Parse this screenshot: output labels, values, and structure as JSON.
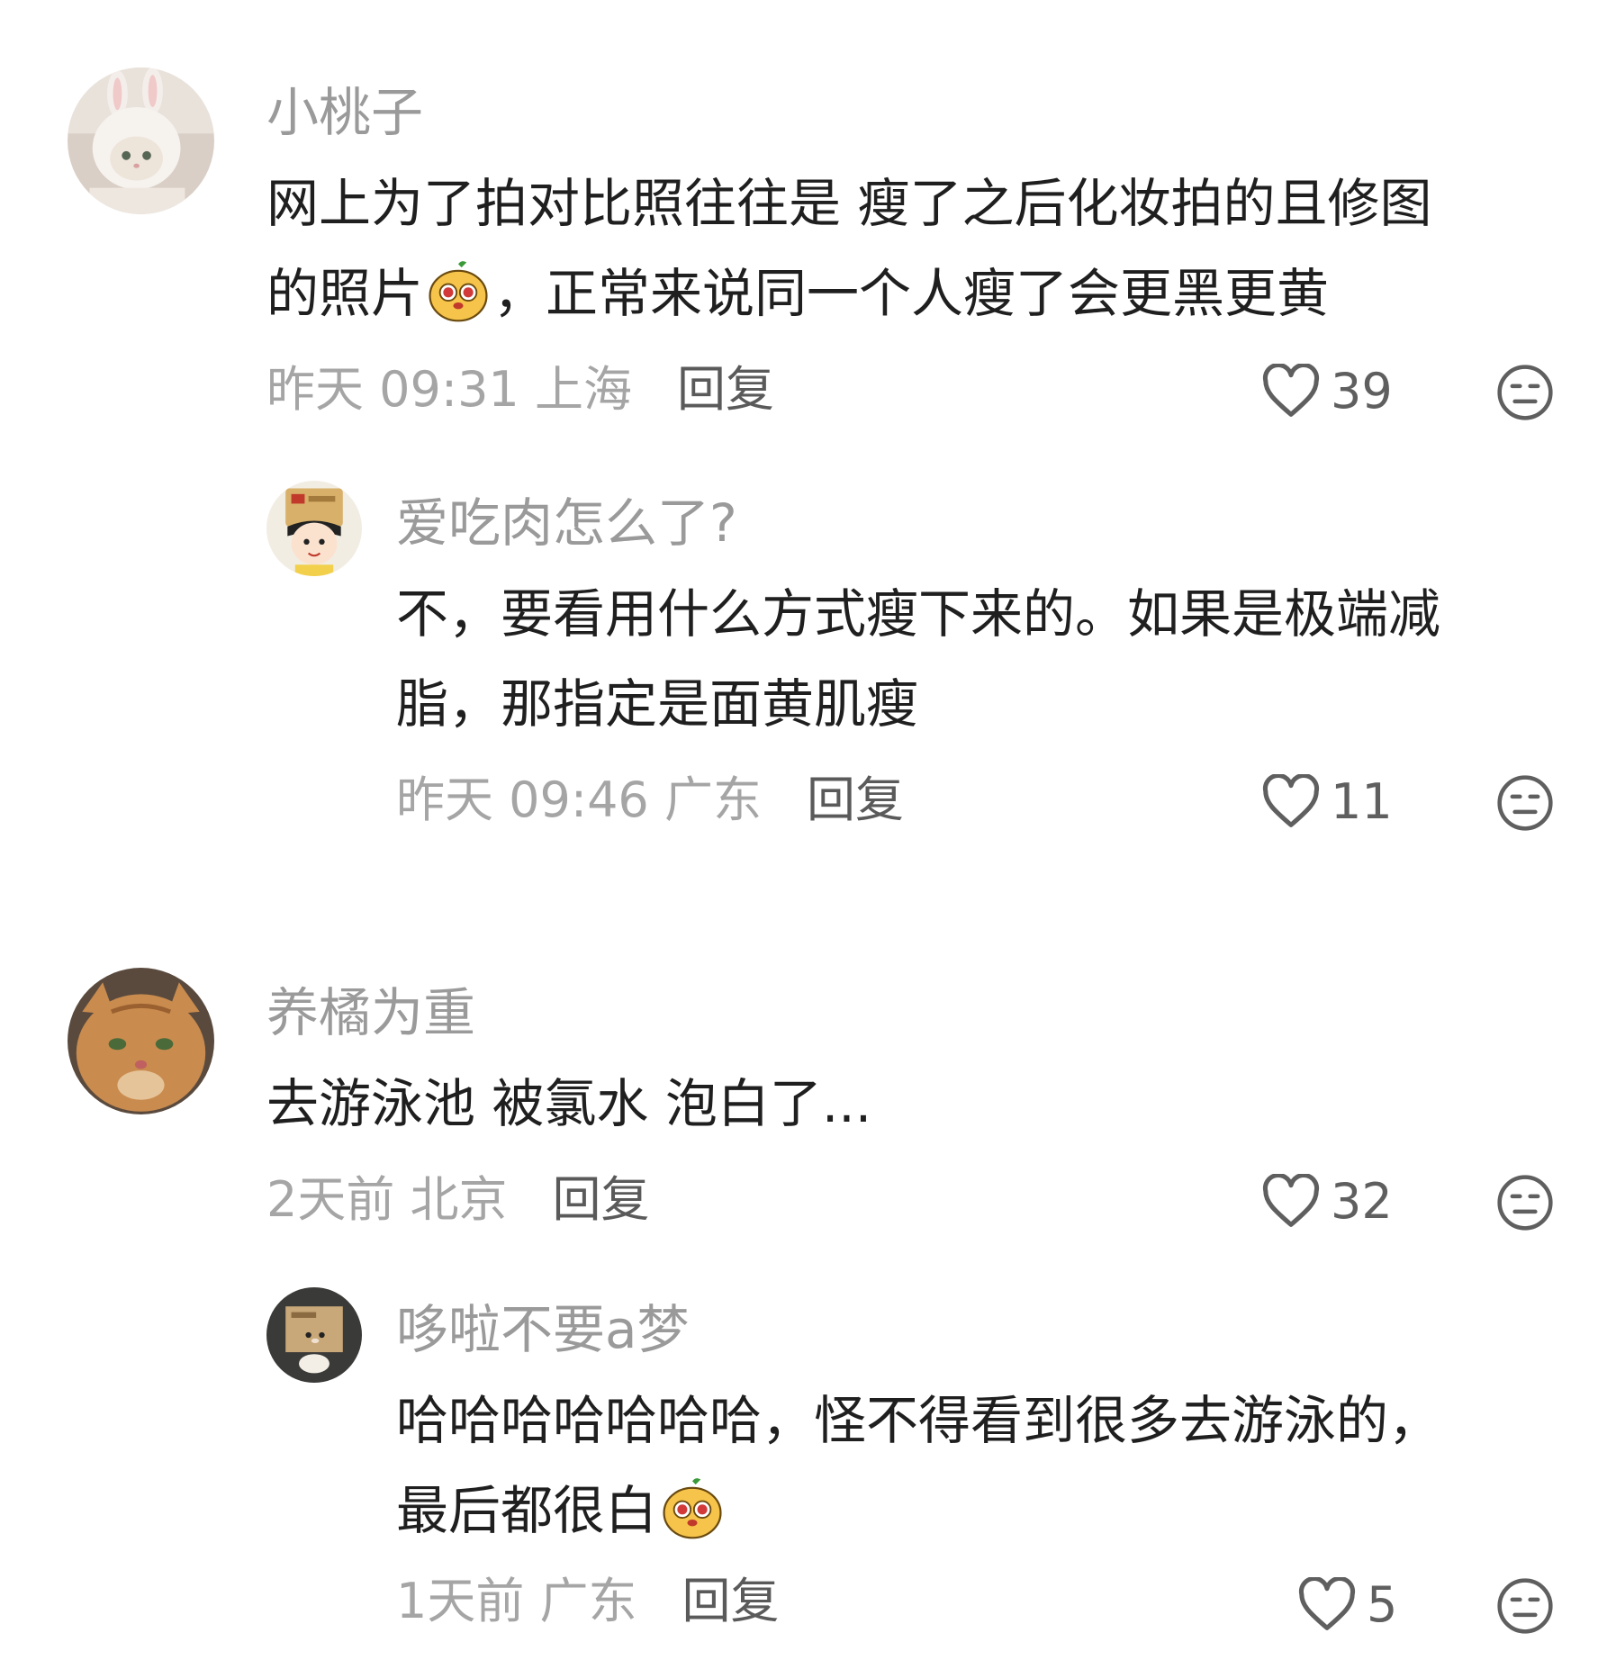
{
  "comments": [
    {
      "username": "小桃子",
      "lines": [
        "网上为了拍对比照往往是 瘦了之后化妆拍的且修图",
        "的照片",
        "，正常来说同一个人瘦了会更黑更黄"
      ],
      "meta": "昨天 09:31 上海",
      "reply": "回复",
      "likes": "39",
      "avatar": "white-cat-bunny-hat-avatar"
    },
    {
      "username": "爱吃肉怎么了?",
      "lines": [
        "不，要看用什么方式瘦下来的。如果是极端减",
        "脂，那指定是面黄肌瘦"
      ],
      "meta": "昨天 09:46 广东",
      "reply": "回复",
      "likes": "11",
      "avatar": "cartoon-girl-avatar"
    },
    {
      "username": "养橘为重",
      "lines": [
        "去游泳池 被氯水 泡白了..."
      ],
      "meta": "2天前 北京",
      "reply": "回复",
      "likes": "32",
      "avatar": "orange-cat-avatar"
    },
    {
      "username": "哆啦不要a梦",
      "lines": [
        "哈哈哈哈哈哈哈，怪不得看到很多去游泳的，",
        "最后都很白"
      ],
      "meta": "1天前 广东",
      "reply": "回复",
      "likes": "5",
      "avatar": "box-figure-avatar"
    }
  ],
  "colors": {
    "username": "#9a9a9a",
    "text": "#1f1f1f",
    "meta": "#a5a5a5",
    "reply": "#5a5a5a",
    "icon": "#5f5f5f"
  },
  "icons": [
    "heart-outline-icon",
    "meh-face-icon",
    "dog-emoji-icon"
  ]
}
